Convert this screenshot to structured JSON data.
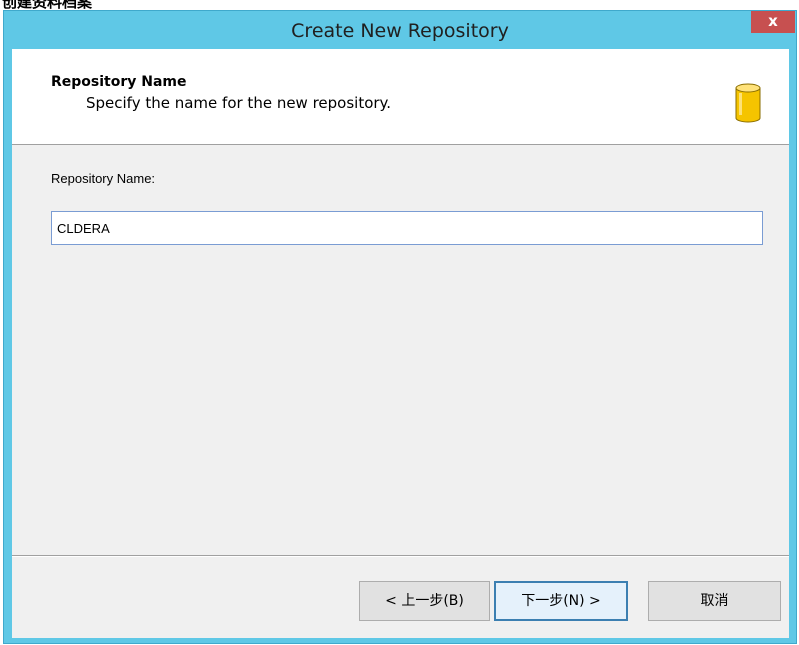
{
  "page_fragment": {
    "text": "创建资料档案"
  },
  "window": {
    "title": "Create New Repository",
    "close_label": "x"
  },
  "header": {
    "title": "Repository Name",
    "subtitle": "Specify the name for the new repository.",
    "icon": "database-icon",
    "icon_color": "#f5c400"
  },
  "form": {
    "field_label": "Repository Name:",
    "field_value": "CLDERA"
  },
  "buttons": {
    "back": "< 上一步(B)",
    "next": "下一步(N) >",
    "cancel": "取消"
  },
  "colors": {
    "titlebar": "#5fc8e6",
    "close_button": "#c75050",
    "default_button_border": "#3c7fb1"
  }
}
